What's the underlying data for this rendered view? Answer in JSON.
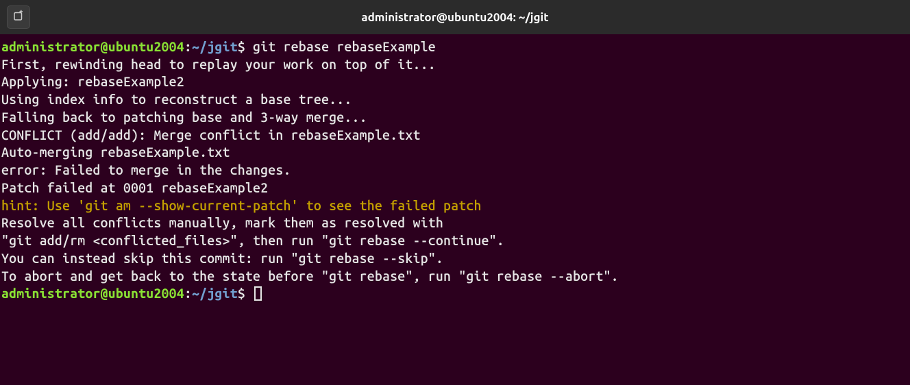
{
  "titlebar": {
    "title": "administrator@ubuntu2004: ~/jgit"
  },
  "prompt": {
    "userhost": "administrator@ubuntu2004",
    "colon": ":",
    "path": "~/jgit",
    "symbol": "$"
  },
  "command1": " git rebase rebaseExample",
  "output": {
    "l1": "First, rewinding head to replay your work on top of it...",
    "l2": "Applying: rebaseExample2",
    "l3": "Using index info to reconstruct a base tree...",
    "l4": "Falling back to patching base and 3-way merge...",
    "l5": "CONFLICT (add/add): Merge conflict in rebaseExample.txt",
    "l6": "Auto-merging rebaseExample.txt",
    "l7": "error: Failed to merge in the changes.",
    "l8": "Patch failed at 0001 rebaseExample2",
    "l9": "hint: Use 'git am --show-current-patch' to see the failed patch",
    "l10": "Resolve all conflicts manually, mark them as resolved with",
    "l11": "\"git add/rm <conflicted_files>\", then run \"git rebase --continue\".",
    "l12": "You can instead skip this commit: run \"git rebase --skip\".",
    "l13": "To abort and get back to the state before \"git rebase\", run \"git rebase --abort\"."
  }
}
